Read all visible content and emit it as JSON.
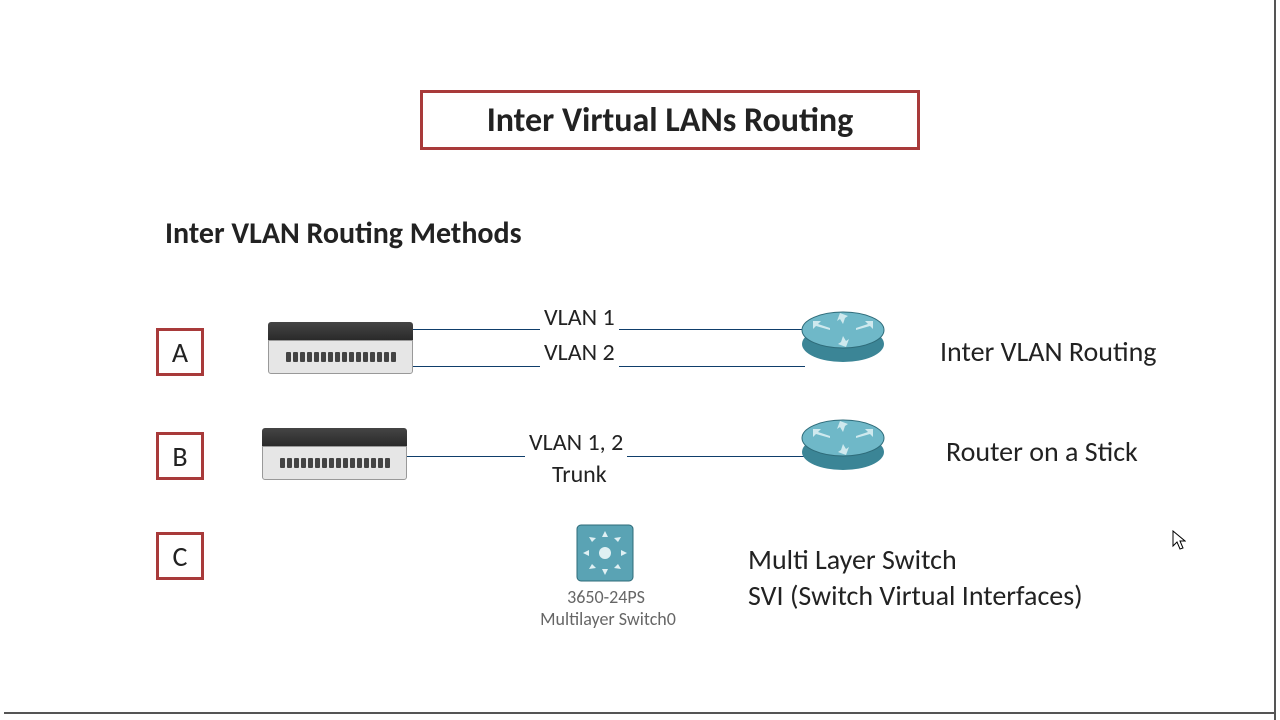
{
  "title": "Inter Virtual LANs Routing",
  "section": "Inter VLAN Routing Methods",
  "rows": {
    "a": {
      "letter": "A",
      "link_top": "VLAN 1",
      "link_bottom": "VLAN 2",
      "method": "Inter VLAN Routing"
    },
    "b": {
      "letter": "B",
      "link_top": "VLAN 1, 2",
      "link_bottom": "Trunk",
      "method": "Router on a Stick"
    },
    "c": {
      "letter": "C",
      "caption_model": "3650-24PS",
      "caption_name": "Multilayer Switch0",
      "method_line1": "Multi Layer Switch",
      "method_line2": "SVI (Switch Virtual Interfaces)"
    }
  },
  "colors": {
    "border_red": "#a83a3a",
    "link_navy": "#0f3e6b",
    "router_teal": "#4fa0b0"
  }
}
